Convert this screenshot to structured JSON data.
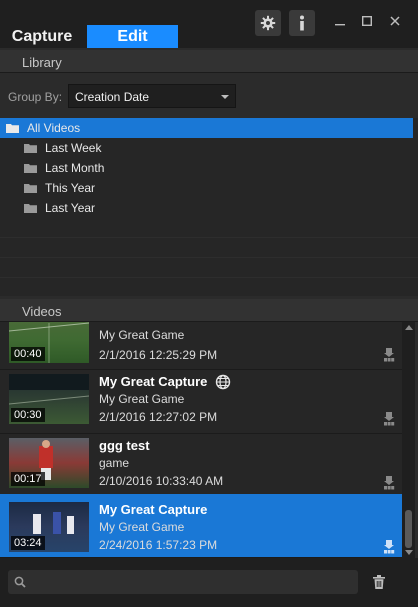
{
  "tabs": {
    "capture": "Capture",
    "edit": "Edit"
  },
  "library": {
    "header": "Library",
    "group_by_label": "Group By:",
    "group_by_value": "Creation Date",
    "tree": {
      "root": "All Videos",
      "children": [
        "Last Week",
        "Last Month",
        "This Year",
        "Last Year"
      ]
    }
  },
  "videos": {
    "header": "Videos",
    "items": [
      {
        "title": "",
        "game": "My Great Game",
        "date": "2/1/2016 12:25:29 PM",
        "duration": "00:40"
      },
      {
        "title": "My Great Capture",
        "game": "My Great Game",
        "date": "2/1/2016 12:27:02 PM",
        "duration": "00:30"
      },
      {
        "title": "ggg test",
        "game": "game",
        "date": "2/10/2016 10:33:40 AM",
        "duration": "00:17"
      },
      {
        "title": "My Great Capture",
        "game": "My Great Game",
        "date": "2/24/2016 1:57:23 PM",
        "duration": "03:24"
      }
    ]
  },
  "search": {
    "placeholder": ""
  },
  "colors": {
    "accent": "#1a8cff",
    "selection": "#1a78d6",
    "background": "#2b2b2b"
  },
  "icons": [
    "gear-icon",
    "info-icon",
    "minimize-icon",
    "maximize-icon",
    "close-icon",
    "folder-icon",
    "globe-icon",
    "pro-badge-icon",
    "search-icon",
    "trash-icon"
  ]
}
